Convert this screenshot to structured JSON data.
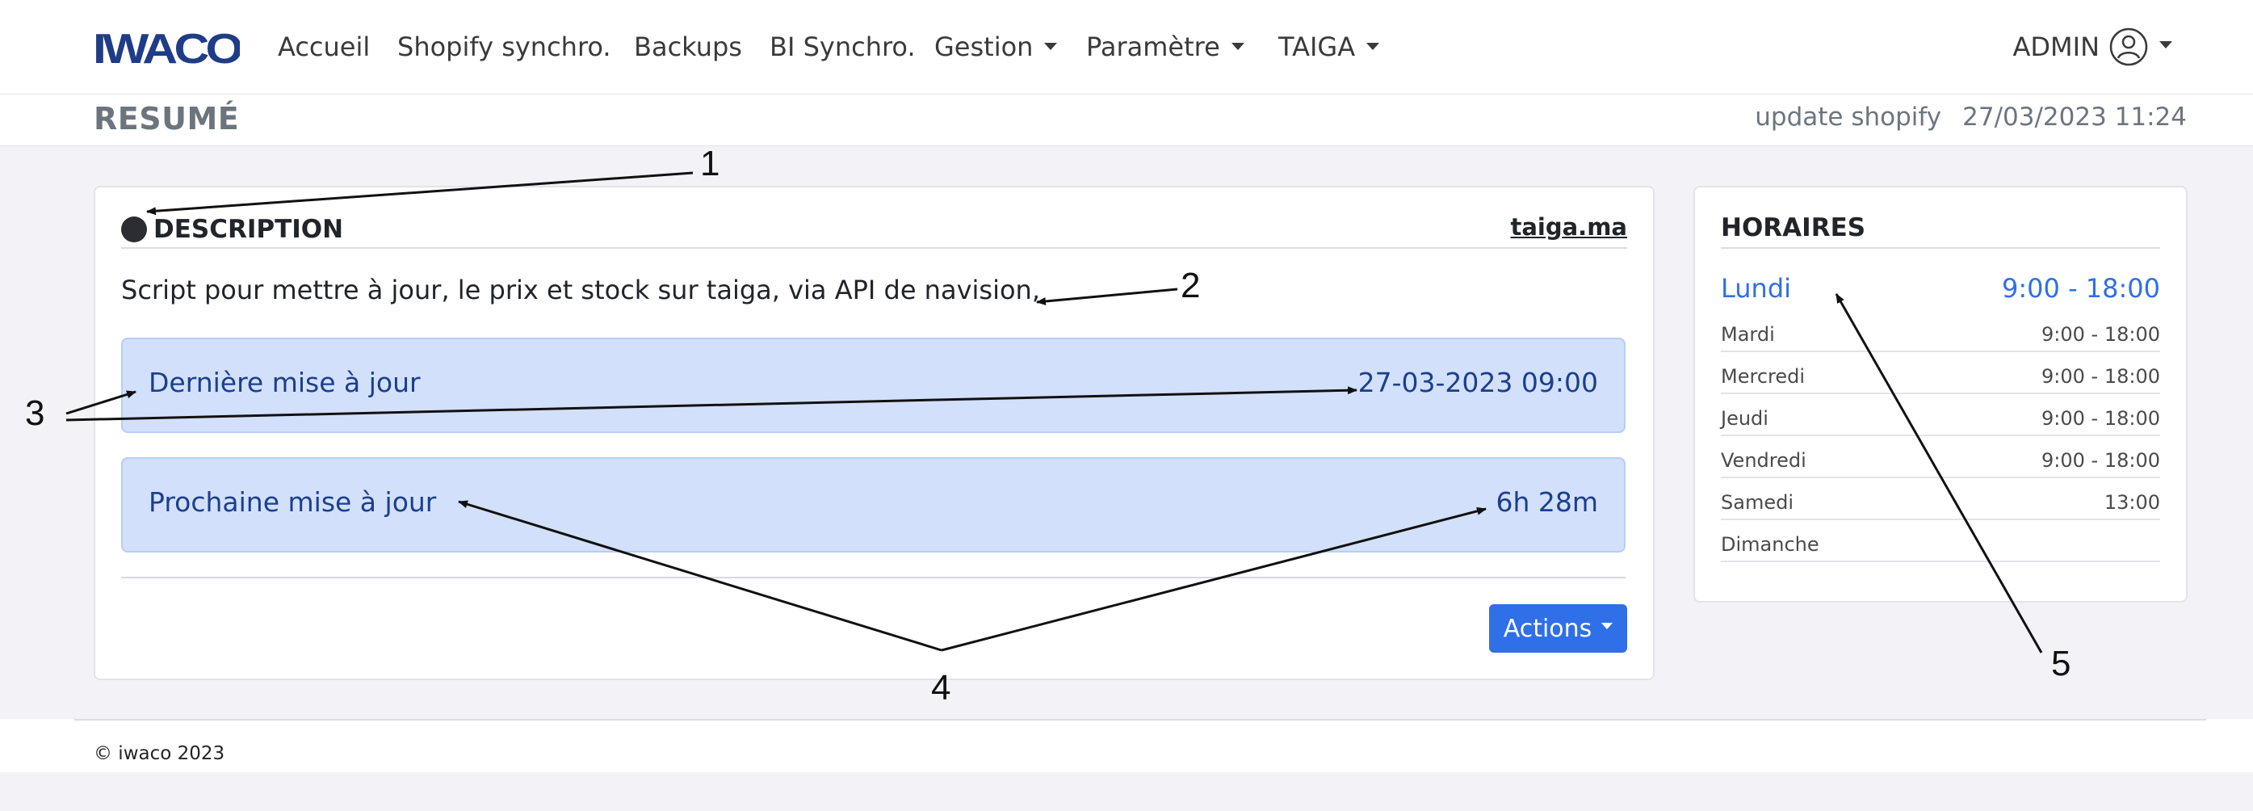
{
  "brand": {
    "logo_text": "IWACO",
    "logo_color": "#1f3c88"
  },
  "nav": {
    "items": [
      {
        "label": "Accueil"
      },
      {
        "label": "Shopify synchro."
      },
      {
        "label": "Backups"
      },
      {
        "label": "BI Synchro."
      },
      {
        "label": "Gestion",
        "dropdown": true
      },
      {
        "label": "Paramètre",
        "dropdown": true
      },
      {
        "label": "TAIGA",
        "dropdown": true
      }
    ],
    "user": {
      "label": "ADMIN",
      "icon": "user-circle-icon"
    }
  },
  "subheader": {
    "title": "RESUMÉ",
    "update_label": "update shopify",
    "update_datetime": "27/03/2023 11:24"
  },
  "description": {
    "title": "DESCRIPTION",
    "link": "taiga.ma",
    "text": "Script pour mettre à jour, le prix et stock sur taiga, via API de navision,",
    "last_update": {
      "label": "Dernière mise à jour",
      "value": "27-03-2023 09:00"
    },
    "next_update": {
      "label": "Prochaine mise à jour",
      "value": "6h 28m"
    },
    "actions_label": "Actions"
  },
  "hours": {
    "title": "HORAIRES",
    "today": {
      "day": "Lundi",
      "time": "9:00 - 18:00"
    },
    "days": [
      {
        "day": "Mardi",
        "time": "9:00 - 18:00"
      },
      {
        "day": "Mercredi",
        "time": "9:00 - 18:00"
      },
      {
        "day": "Jeudi",
        "time": "9:00 - 18:00"
      },
      {
        "day": "Vendredi",
        "time": "9:00 - 18:00"
      },
      {
        "day": "Samedi",
        "time": "13:00"
      },
      {
        "day": "Dimanche",
        "time": ""
      }
    ]
  },
  "footer": {
    "text": "© iwaco 2023"
  },
  "annotations": [
    "1",
    "2",
    "3",
    "4",
    "5"
  ],
  "colors": {
    "accent": "#2f6fe8",
    "info_bg": "#d2e0fb",
    "info_text": "#1b3f8c",
    "page_bg": "#f2f2f7"
  }
}
